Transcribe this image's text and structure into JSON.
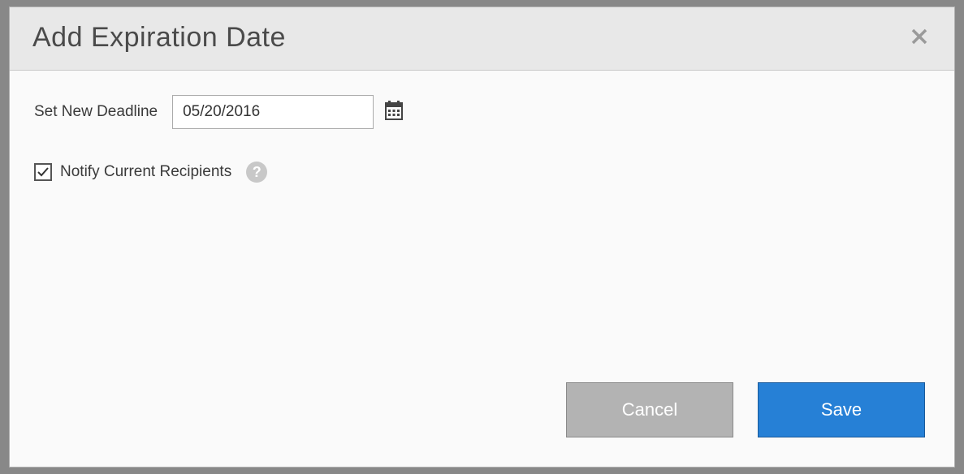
{
  "dialog": {
    "title": "Add Expiration Date",
    "deadline_label": "Set New Deadline",
    "deadline_value": "05/20/2016",
    "notify_label": "Notify Current Recipients",
    "notify_checked": true,
    "cancel_label": "Cancel",
    "save_label": "Save"
  }
}
